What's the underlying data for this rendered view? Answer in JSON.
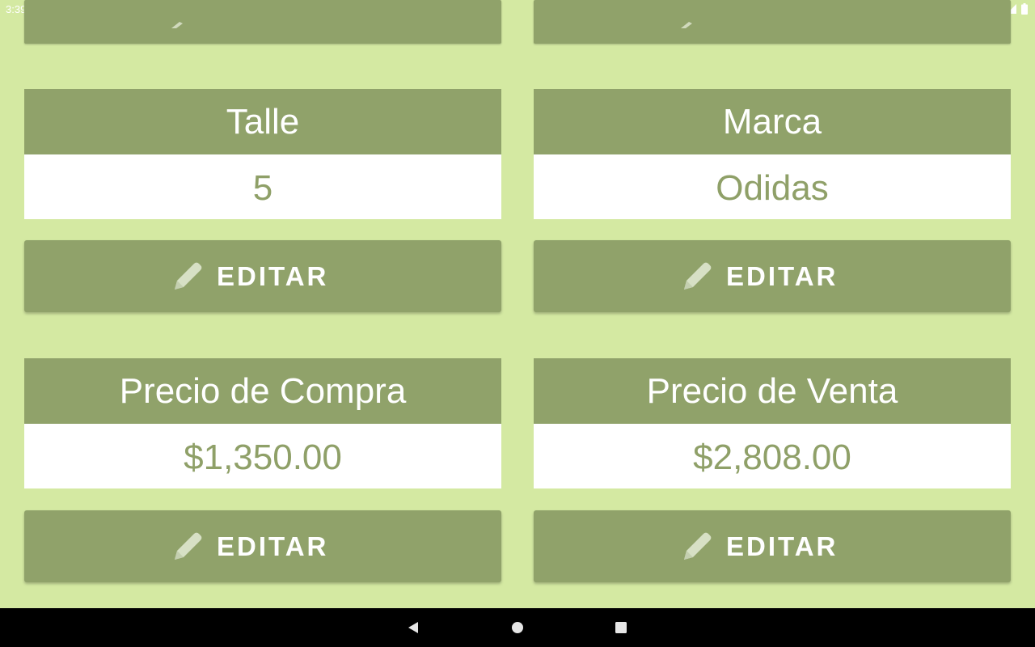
{
  "status_bar": {
    "time": "3:39",
    "icons": [
      "notification-a-icon",
      "notification-p-icon",
      "wifi-icon",
      "signal-icon",
      "battery-icon"
    ]
  },
  "fields": {
    "talle": {
      "label": "Talle",
      "value": "5"
    },
    "marca": {
      "label": "Marca",
      "value": "Odidas"
    },
    "precio_compra": {
      "label": "Precio de Compra",
      "value": "$1,350.00"
    },
    "precio_venta": {
      "label": "Precio de Venta",
      "value": "$2,808.00"
    }
  },
  "buttons": {
    "edit_label": "EDITAR",
    "edit_icon": "pencil-icon"
  },
  "nav_bar": {
    "buttons": [
      "back-icon",
      "home-icon",
      "recents-icon"
    ]
  },
  "colors": {
    "background": "#d4e9a2",
    "header": "#90a26a",
    "value_text": "#8fa068",
    "value_bg": "#ffffff"
  }
}
